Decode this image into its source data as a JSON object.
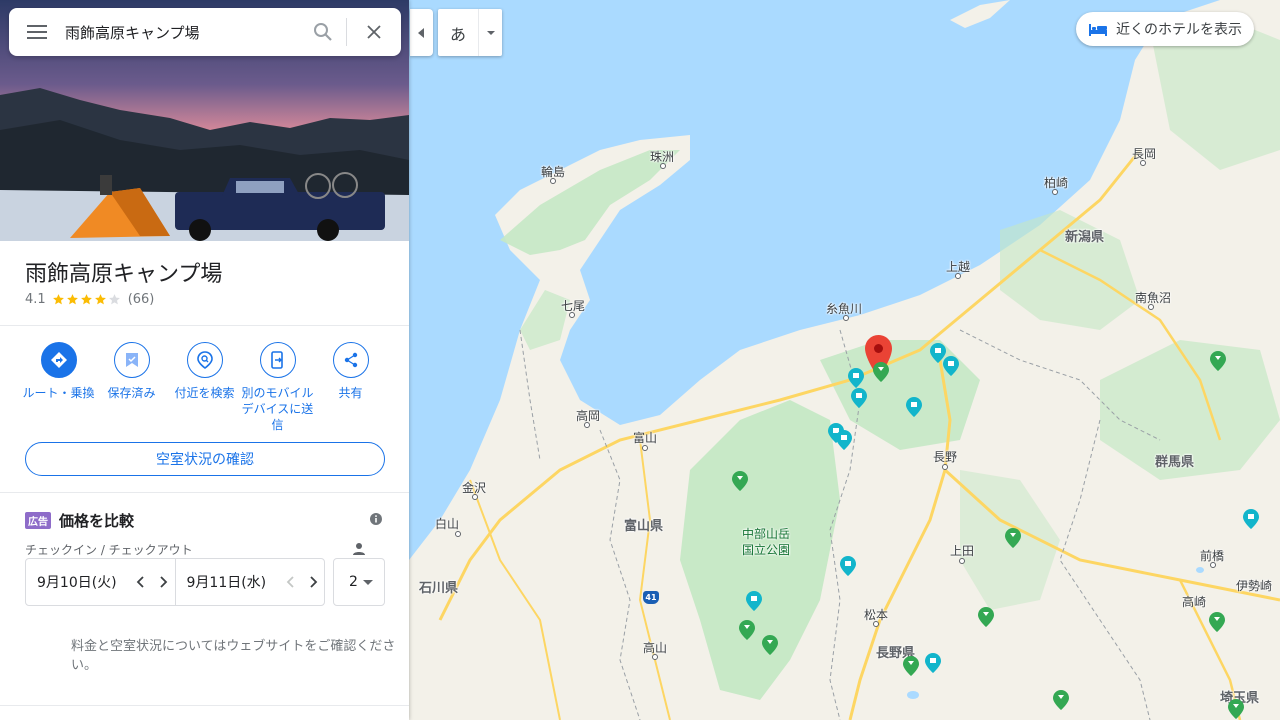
{
  "search": {
    "value": "雨飾高原キャンプ場"
  },
  "place": {
    "title": "雨飾高原キャンプ場",
    "rating": "4.1",
    "rating_value": 4.1,
    "review_count": "(66)"
  },
  "actions": [
    {
      "label": "ルート・乗換",
      "icon": "directions-icon"
    },
    {
      "label": "保存済み",
      "icon": "bookmark-icon"
    },
    {
      "label": "付近を検索",
      "icon": "nearby-icon"
    },
    {
      "label": "別のモバイルデバイスに送信",
      "icon": "send-to-phone-icon"
    },
    {
      "label": "共有",
      "icon": "share-icon"
    }
  ],
  "availability_button": "空室状況の確認",
  "compare": {
    "ad_badge": "広告",
    "title": "価格を比較",
    "checkin_label": "チェックイン / チェックアウト",
    "checkin_date": "9月10日(火)",
    "checkout_date": "9月11日(水)",
    "guests": "2",
    "note": "料金と空室状況についてはウェブサイトをご確認ください。"
  },
  "map": {
    "ime_char": "あ",
    "hotels_chip": "近くのホテルを表示",
    "route_shield": "41",
    "labels": {
      "wajima": "輪島",
      "suzu": "珠洲",
      "nanao": "七尾",
      "takaoka": "高岡",
      "toyama": "富山",
      "kanazawa": "金沢",
      "hakusan": "白山",
      "ishikawa": "石川県",
      "toyama_pref": "富山県",
      "itoigawa": "糸魚川",
      "joetsu": "上越",
      "nagano": "長野",
      "ueda": "上田",
      "matsumoto": "松本",
      "nagano_pref": "長野県",
      "takayama": "高山",
      "niigata_pref": "新潟県",
      "kashiwazaki": "柏崎",
      "nagaoka": "長岡",
      "minamiuonuma": "南魚沼",
      "gunma_pref": "群馬県",
      "maebashi": "前橋",
      "takasaki": "高崎",
      "isesaki": "伊勢崎",
      "saitama_pref": "埼玉県",
      "chubu_park": "中部山岳\n国立公園"
    }
  },
  "colors": {
    "accent": "#1a73e8",
    "sea": "#aadaff",
    "land": "#f3f1e9",
    "forest": "#c5e8c5",
    "pin_red": "#ea4335",
    "pin_teal": "#12b5cb",
    "pin_green": "#34a853"
  }
}
